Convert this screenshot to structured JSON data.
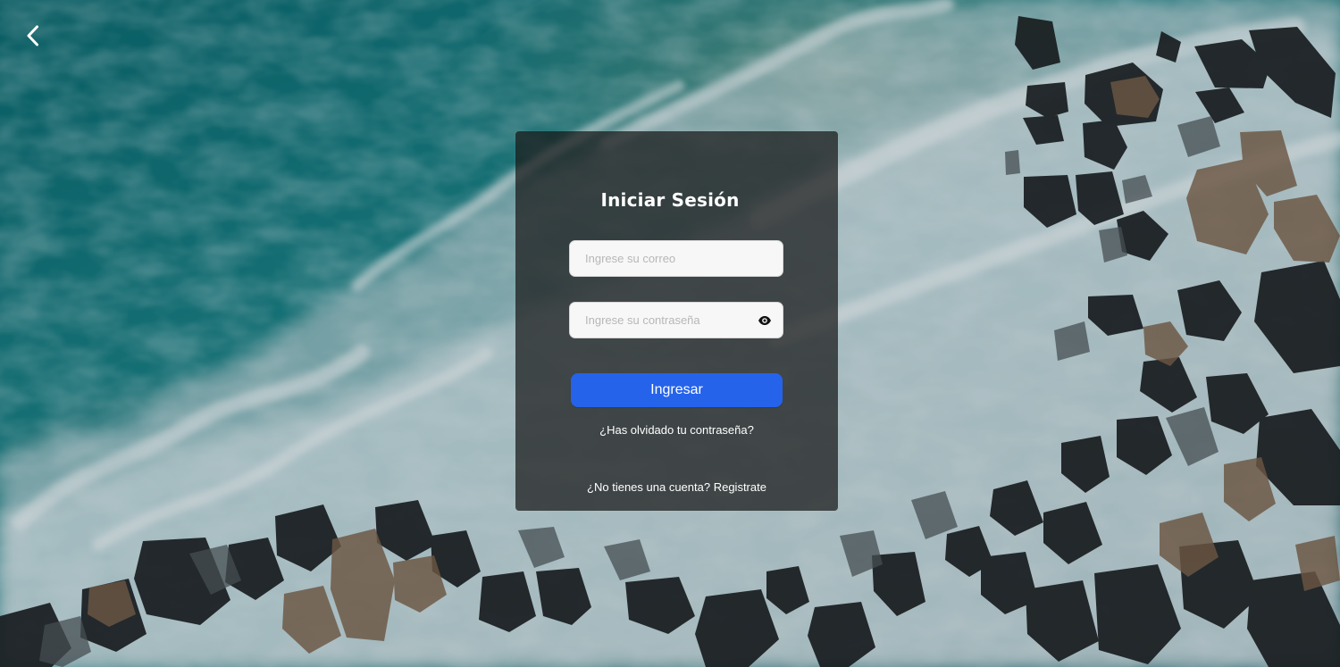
{
  "colors": {
    "ocean_deep": "#0d5f67",
    "ocean_light": "#1b8d8f",
    "foam": "#e6eef2",
    "rock_dark": "#1c1e20",
    "rock_brown": "#7d5a3e",
    "card_overlay": "rgba(24,24,24,0.72)",
    "accent": "#2563eb",
    "text": "#ffffff"
  },
  "navigation": {
    "back_icon": "chevron-left-icon"
  },
  "login": {
    "title": "Iniciar Sesión",
    "email": {
      "value": "",
      "placeholder": "Ingrese su correo"
    },
    "password": {
      "value": "",
      "placeholder": "Ingrese su contraseña",
      "toggle_icon": "eye-icon"
    },
    "submit_label": "Ingresar",
    "forgot_password_label": "¿Has olvidado tu contraseña?",
    "register_prompt": "¿No tienes una cuenta? ",
    "register_label": "Registrate"
  }
}
